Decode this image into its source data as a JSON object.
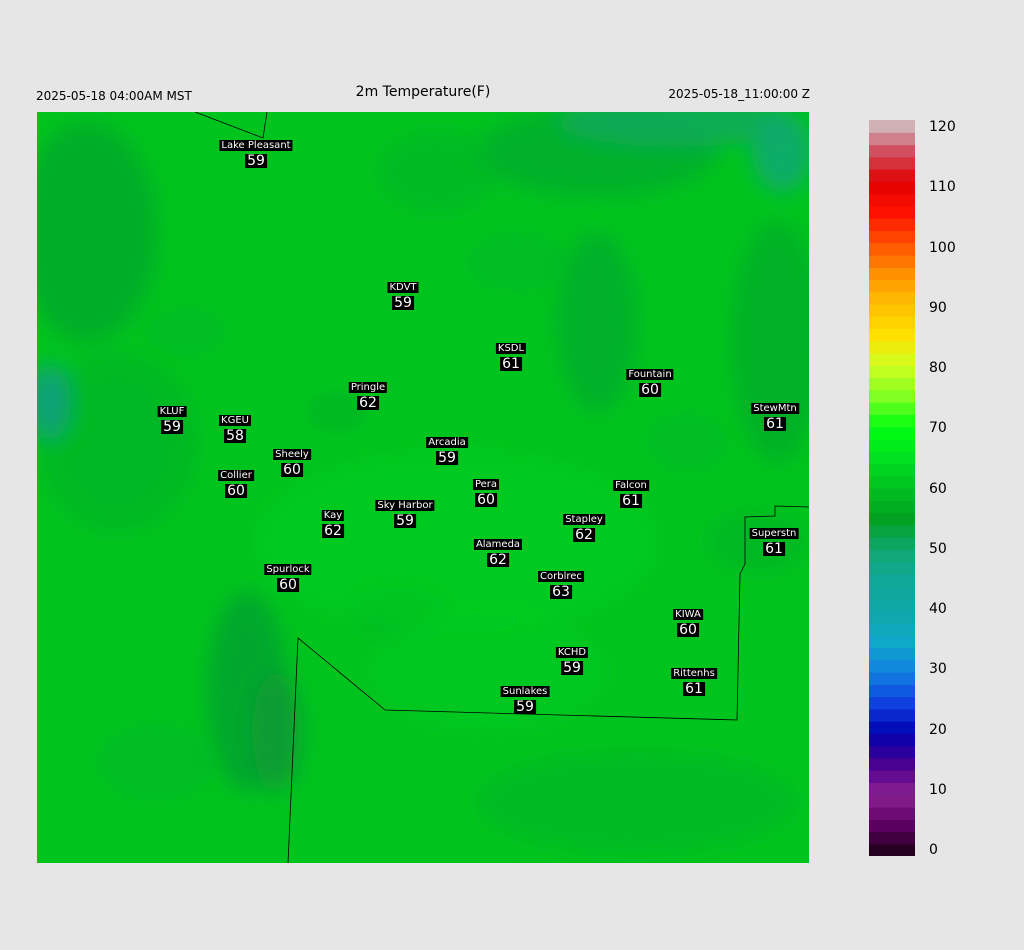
{
  "header": {
    "title": "2m Temperature(F)",
    "local_time": "2025-05-18 04:00AM MST",
    "valid_time": "2025-05-18_11:00:00 Z"
  },
  "map": {
    "background_color": "#00c41e",
    "boundary_color": "#000000"
  },
  "colorbar": {
    "min": 0,
    "max": 120,
    "labels": [
      "0",
      "10",
      "20",
      "30",
      "40",
      "50",
      "60",
      "70",
      "80",
      "90",
      "100",
      "110",
      "120"
    ],
    "stops": [
      {
        "v": 0,
        "c": "#1a0010"
      },
      {
        "v": 5,
        "c": "#5a0060"
      },
      {
        "v": 10,
        "c": "#8a2090"
      },
      {
        "v": 15,
        "c": "#4a0090"
      },
      {
        "v": 20,
        "c": "#0000b0"
      },
      {
        "v": 25,
        "c": "#1040e0"
      },
      {
        "v": 30,
        "c": "#1080e0"
      },
      {
        "v": 35,
        "c": "#10a8c8"
      },
      {
        "v": 40,
        "c": "#10a8a8"
      },
      {
        "v": 45,
        "c": "#10a898"
      },
      {
        "v": 50,
        "c": "#10a870"
      },
      {
        "v": 55,
        "c": "#00a020"
      },
      {
        "v": 60,
        "c": "#00c020"
      },
      {
        "v": 65,
        "c": "#00e020"
      },
      {
        "v": 70,
        "c": "#00ff10"
      },
      {
        "v": 75,
        "c": "#80ff20"
      },
      {
        "v": 80,
        "c": "#d0ff20"
      },
      {
        "v": 85,
        "c": "#ffe000"
      },
      {
        "v": 90,
        "c": "#ffc000"
      },
      {
        "v": 95,
        "c": "#ff9000"
      },
      {
        "v": 100,
        "c": "#ff5000"
      },
      {
        "v": 105,
        "c": "#ff1000"
      },
      {
        "v": 110,
        "c": "#e00000"
      },
      {
        "v": 115,
        "c": "#d05060"
      },
      {
        "v": 120,
        "c": "#d0c8c8"
      }
    ]
  },
  "stations": [
    {
      "name": "Lake Pleasant",
      "value": "59"
    },
    {
      "name": "KDVT",
      "value": "59"
    },
    {
      "name": "KSDL",
      "value": "61"
    },
    {
      "name": "Fountain",
      "value": "60"
    },
    {
      "name": "Pringle",
      "value": "62"
    },
    {
      "name": "KLUF",
      "value": "59"
    },
    {
      "name": "KGEU",
      "value": "58"
    },
    {
      "name": "StewMtn",
      "value": "61"
    },
    {
      "name": "Arcadia",
      "value": "59"
    },
    {
      "name": "Sheely",
      "value": "60"
    },
    {
      "name": "Collier",
      "value": "60"
    },
    {
      "name": "Pera",
      "value": "60"
    },
    {
      "name": "Falcon",
      "value": "61"
    },
    {
      "name": "Kay",
      "value": "62"
    },
    {
      "name": "Sky Harbor",
      "value": "59"
    },
    {
      "name": "Stapley",
      "value": "62"
    },
    {
      "name": "Superstn",
      "value": "61"
    },
    {
      "name": "Alameda",
      "value": "62"
    },
    {
      "name": "Spurlock",
      "value": "60"
    },
    {
      "name": "Corblrec",
      "value": "63"
    },
    {
      "name": "KIWA",
      "value": "60"
    },
    {
      "name": "KCHD",
      "value": "59"
    },
    {
      "name": "Rittenhs",
      "value": "61"
    },
    {
      "name": "Sunlakes",
      "value": "59"
    }
  ]
}
